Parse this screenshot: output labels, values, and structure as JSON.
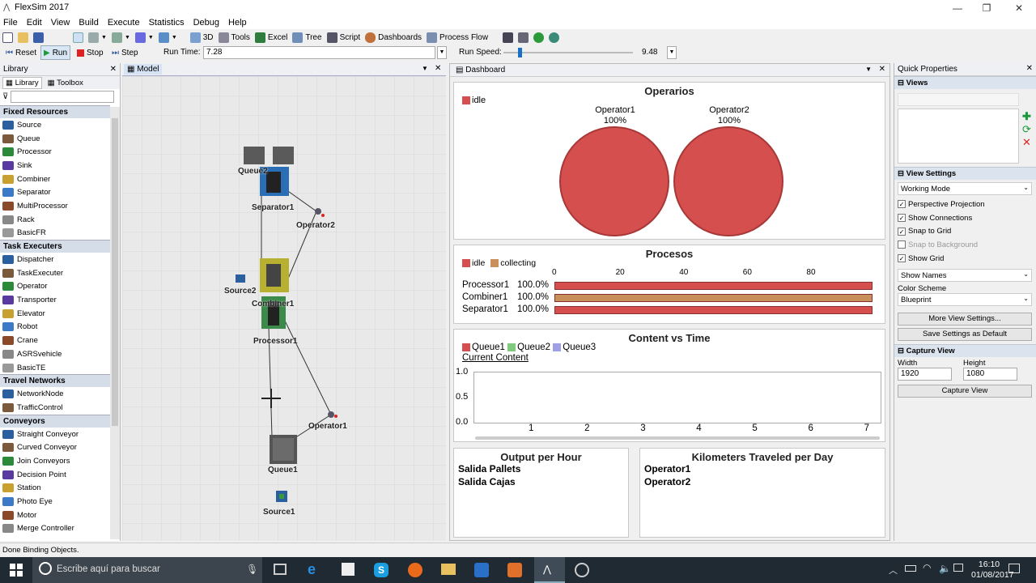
{
  "app": {
    "title": "FlexSim 2017"
  },
  "menu": [
    "File",
    "Edit",
    "View",
    "Build",
    "Execute",
    "Statistics",
    "Debug",
    "Help"
  ],
  "toolbar": {
    "items": [
      "3D",
      "Tools",
      "Excel",
      "Tree",
      "Script",
      "Dashboards",
      "Process Flow"
    ]
  },
  "runbar": {
    "reset": "Reset",
    "run": "Run",
    "stop": "Stop",
    "step": "Step",
    "run_time_label": "Run Time:",
    "run_time_value": "7.28",
    "run_speed_label": "Run Speed:",
    "run_speed_value": "9.48",
    "run_speed_fraction": 0.05
  },
  "library": {
    "title": "Library",
    "tabs": [
      "Library",
      "Toolbox"
    ],
    "sections": [
      {
        "name": "Fixed Resources",
        "items": [
          "Source",
          "Queue",
          "Processor",
          "Sink",
          "Combiner",
          "Separator",
          "MultiProcessor",
          "Rack",
          "BasicFR"
        ]
      },
      {
        "name": "Task Executers",
        "items": [
          "Dispatcher",
          "TaskExecuter",
          "Operator",
          "Transporter",
          "Elevator",
          "Robot",
          "Crane",
          "ASRSvehicle",
          "BasicTE"
        ]
      },
      {
        "name": "Travel Networks",
        "items": [
          "NetworkNode",
          "TrafficControl"
        ]
      },
      {
        "name": "Conveyors",
        "items": [
          "Straight Conveyor",
          "Curved Conveyor",
          "Join Conveyors",
          "Decision Point",
          "Station",
          "Photo Eye",
          "Motor",
          "Merge Controller"
        ]
      }
    ]
  },
  "model": {
    "tab": "Model",
    "objects": [
      "Queue2",
      "Separator1",
      "Operator2",
      "Source2",
      "Combiner1",
      "Processor1",
      "Operator1",
      "Queue1",
      "Source1"
    ]
  },
  "dashboard": {
    "tab": "Dashboard",
    "operarios": {
      "title": "Operarios",
      "legend": "idle",
      "ops": [
        {
          "name": "Operator1",
          "pct": "100%"
        },
        {
          "name": "Operator2",
          "pct": "100%"
        }
      ]
    },
    "procesos": {
      "title": "Procesos",
      "legend": [
        "idle",
        "collecting"
      ],
      "ticks": [
        "0",
        "20",
        "40",
        "60",
        "80"
      ],
      "rows": [
        {
          "name": "Processor1",
          "pct": "100.0%",
          "color": "#d64f4f"
        },
        {
          "name": "Combiner1",
          "pct": "100.0%",
          "color": "#c8905a"
        },
        {
          "name": "Separator1",
          "pct": "100.0%",
          "color": "#d64f4f"
        }
      ]
    },
    "content": {
      "title": "Content vs Time",
      "legend": [
        "Queue1",
        "Queue2",
        "Queue3"
      ],
      "sublabel": "Current Content",
      "yticks": [
        "1.0",
        "0.5",
        "0.0"
      ],
      "xticks": [
        "1",
        "2",
        "3",
        "4",
        "5",
        "6",
        "7"
      ]
    },
    "output": {
      "title": "Output per Hour",
      "rows": [
        "Salida Pallets",
        "Salida Cajas"
      ]
    },
    "km": {
      "title": "Kilometers Traveled per Day",
      "rows": [
        "Operator1",
        "Operator2"
      ]
    }
  },
  "quick": {
    "title": "Quick Properties",
    "views": "Views",
    "view_settings": "View Settings",
    "mode": "Working Mode",
    "checks": [
      {
        "label": "Perspective Projection",
        "on": true
      },
      {
        "label": "Show Connections",
        "on": true
      },
      {
        "label": "Snap to Grid",
        "on": true
      },
      {
        "label": "Snap to Background",
        "on": false
      },
      {
        "label": "Show Grid",
        "on": true
      }
    ],
    "names": "Show Names",
    "color_scheme_label": "Color Scheme",
    "color_scheme": "Blueprint",
    "more": "More View Settings...",
    "save": "Save Settings as Default",
    "capture_title": "Capture View",
    "width_label": "Width",
    "width": "1920",
    "height_label": "Height",
    "height": "1080",
    "capture_btn": "Capture View"
  },
  "status": "Done Binding Objects.",
  "taskbar": {
    "search": "Escribe aquí para buscar",
    "time": "16:10",
    "date": "01/08/2017"
  }
}
